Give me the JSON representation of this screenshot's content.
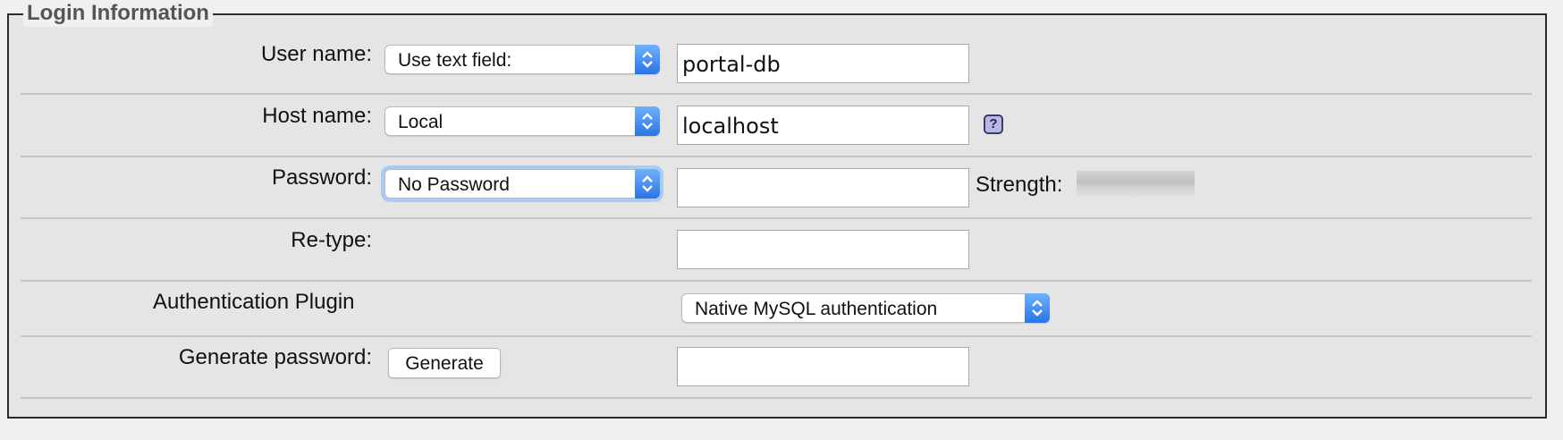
{
  "fieldset": {
    "legend": "Login Information"
  },
  "rows": {
    "user": {
      "label": "User name:",
      "select": "Use text field:",
      "value": "portal-db"
    },
    "host": {
      "label": "Host name:",
      "select": "Local",
      "value": "localhost",
      "help_icon": "question-icon"
    },
    "password": {
      "label": "Password:",
      "select": "No Password",
      "value": "",
      "strength_label": "Strength:",
      "strength_level": 0
    },
    "retype": {
      "label": "Re-type:",
      "value": ""
    },
    "auth": {
      "label": "Authentication Plugin",
      "select": "Native MySQL authentication"
    },
    "generate": {
      "label": "Generate password:",
      "button": "Generate",
      "value": ""
    }
  },
  "colors": {
    "select_arrow": "#2a74e8",
    "focus_ring": "#a9ccf5"
  }
}
